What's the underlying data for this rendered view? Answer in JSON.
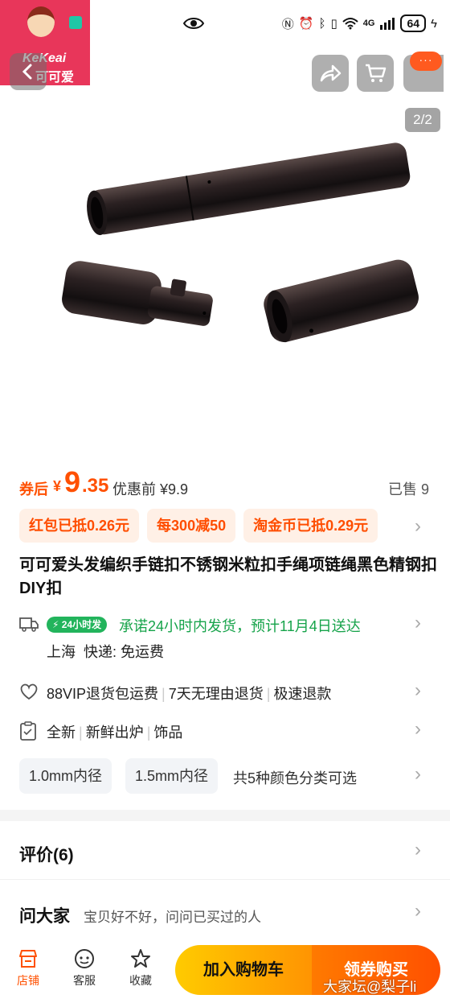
{
  "status_bar": {
    "network": "4G",
    "battery": "64"
  },
  "logo": {
    "brand_en": "KeKeai",
    "brand_cn": "可可爱"
  },
  "gallery": {
    "page_indicator": "2/2"
  },
  "price": {
    "label": "券后",
    "currency": "¥",
    "integer": "9",
    "decimal": ".35",
    "original_label": "优惠前 ¥9.9",
    "sold": "已售 9"
  },
  "coupons": [
    {
      "label": "红包已抵0.26元"
    },
    {
      "label": "每300减50"
    },
    {
      "label": "淘金币已抵0.29元"
    }
  ],
  "product": {
    "title": "可可爱头发编织手链扣不锈钢米粒扣手绳项链绳黑色精钢扣DIY扣"
  },
  "shipping": {
    "tag": "24小时发",
    "promise": "承诺24小时内发货，预计11月4日送达",
    "origin": "上海",
    "express": "快递: 免运费"
  },
  "service": {
    "items": [
      "88VIP退货包运费",
      "7天无理由退货",
      "极速退款"
    ]
  },
  "attributes": {
    "items": [
      "全新",
      "新鲜出炉",
      "饰品"
    ]
  },
  "sku": {
    "options": [
      "1.0mm内径",
      "1.5mm内径"
    ],
    "summary": "共5种颜色分类可选"
  },
  "reviews": {
    "title": "评价(6)"
  },
  "qa": {
    "title": "问大家",
    "subtitle": "宝贝好不好，问问已买过的人"
  },
  "bottom_bar": {
    "shop": "店铺",
    "service": "客服",
    "favorite": "收藏",
    "add_to_cart": "加入购物车",
    "buy_now": "领券购买"
  },
  "watermark": "大家坛@梨子li",
  "colors": {
    "accent": "#ff5000",
    "coupon_bg": "#fff0e6",
    "green": "#16a34a"
  }
}
